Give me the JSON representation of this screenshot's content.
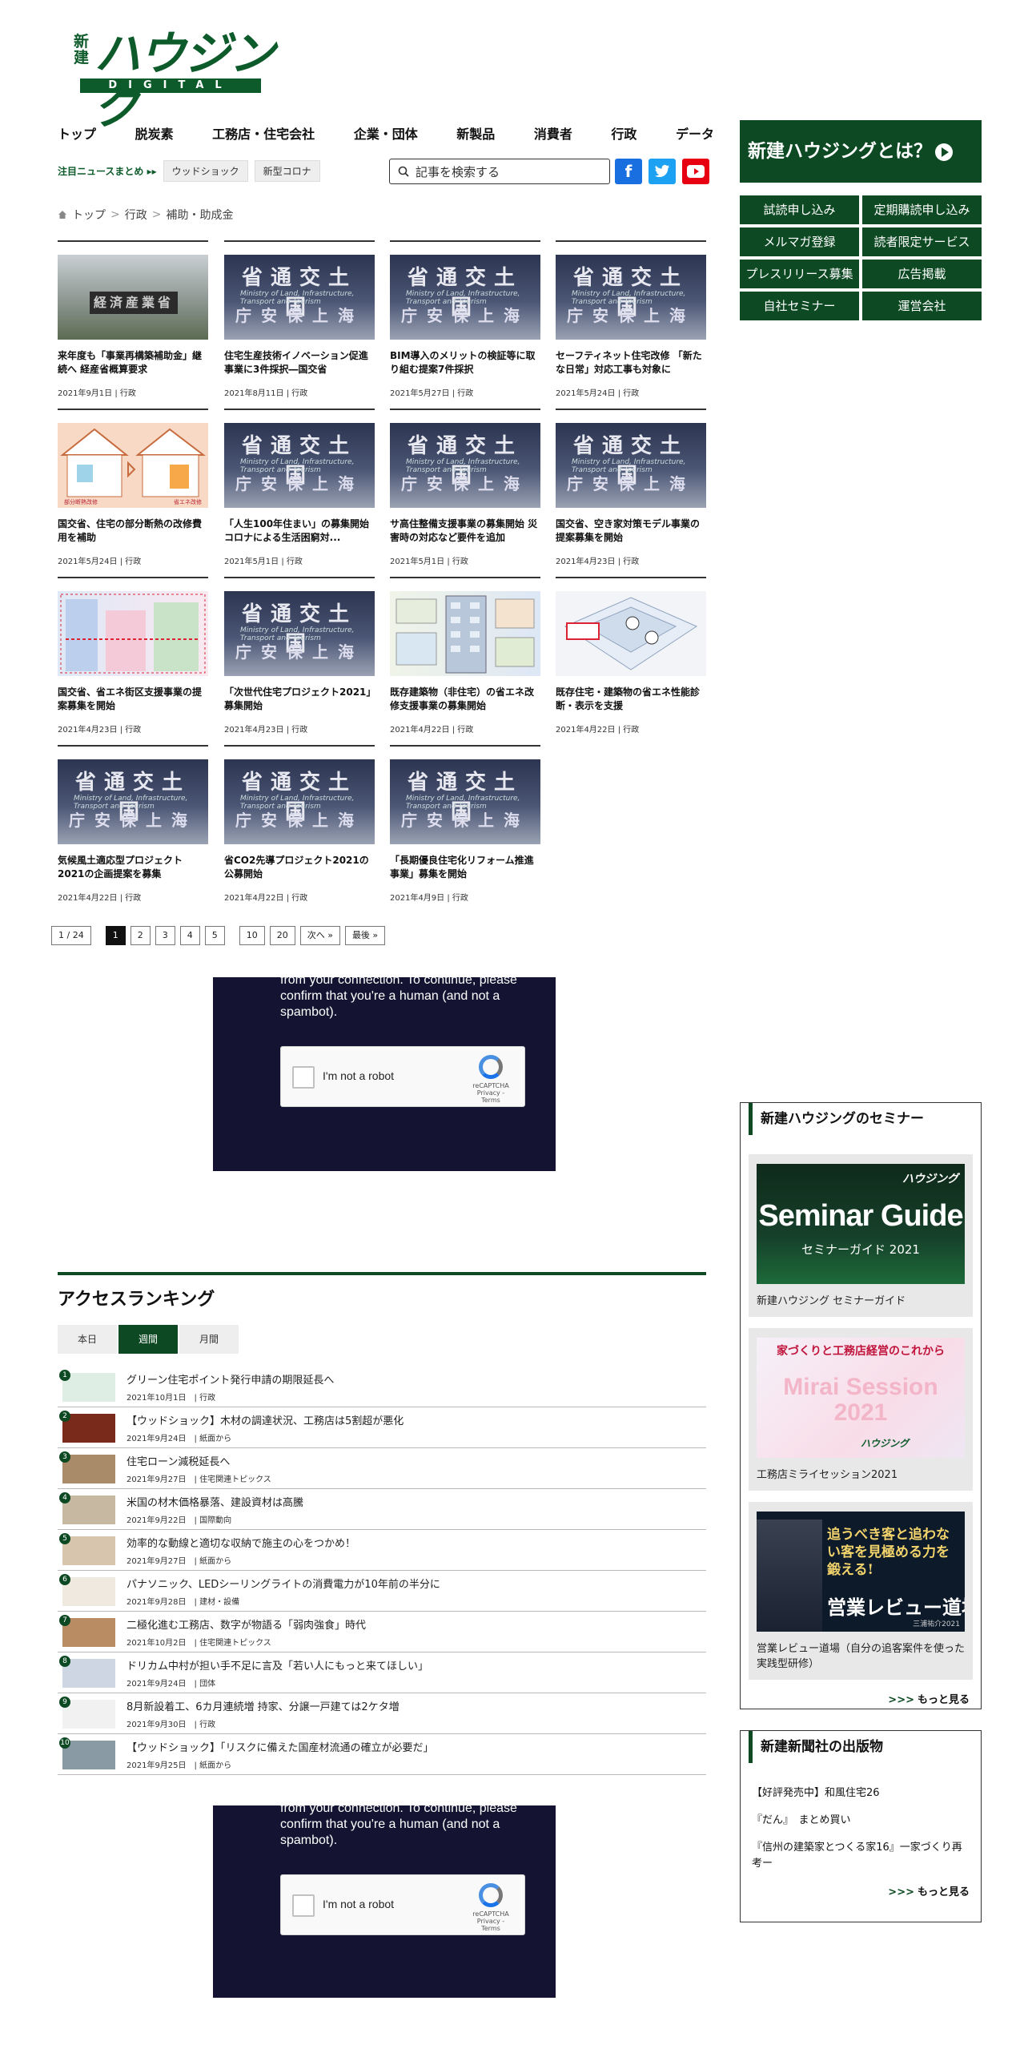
{
  "logo": {
    "prefix": "新建",
    "main": "ハウジング",
    "sub": "DIGITAL"
  },
  "nav": [
    "トップ",
    "脱炭素",
    "工務店・住宅会社",
    "企業・団体",
    "新製品",
    "消費者",
    "行政",
    "データ"
  ],
  "pickup": {
    "label": "注目ニュースまとめ ▸▸",
    "tags": [
      "ウッドショック",
      "新型コロナ"
    ]
  },
  "search": {
    "placeholder": "記事を検索する"
  },
  "sns": {
    "facebook": "f",
    "twitter": "t",
    "youtube": "▶"
  },
  "breadcrumb": [
    "トップ",
    "行政",
    "補助・助成金"
  ],
  "articles": [
    {
      "title": "来年度も「事業再構築補助金」継続へ 経産省概算要求",
      "date": "2021年9月1日",
      "cat": "行政",
      "image": "meti"
    },
    {
      "title": "住宅生産技術イノベーション促進事業に3件採択―国交省",
      "date": "2021年8月11日",
      "cat": "行政",
      "image": "mlit"
    },
    {
      "title": "BIM導入のメリットの検証等に取り組む提案7件採択",
      "date": "2021年5月27日",
      "cat": "行政",
      "image": "mlit"
    },
    {
      "title": "セーフティネット住宅改修 「新たな日常」対応工事も対象に",
      "date": "2021年5月24日",
      "cat": "行政",
      "image": "mlit"
    },
    {
      "title": "国交省、住宅の部分断熱の改修費用を補助",
      "date": "2021年5月24日",
      "cat": "行政",
      "image": "house"
    },
    {
      "title": "「人生100年住まい」の募集開始 コロナによる生活困窮対...",
      "date": "2021年5月1日",
      "cat": "行政",
      "image": "mlit"
    },
    {
      "title": "サ高住整備支援事業の募集開始 災害時の対応など要件を追加",
      "date": "2021年5月1日",
      "cat": "行政",
      "image": "mlit"
    },
    {
      "title": "国交省、空き家対策モデル事業の提案募集を開始",
      "date": "2021年4月23日",
      "cat": "行政",
      "image": "mlit"
    },
    {
      "title": "国交省、省エネ街区支援事業の提案募集を開始",
      "date": "2021年4月23日",
      "cat": "行政",
      "image": "diag"
    },
    {
      "title": "「次世代住宅プロジェクト2021」募集開始",
      "date": "2021年4月23日",
      "cat": "行政",
      "image": "mlit"
    },
    {
      "title": "既存建築物（非住宅）の省エネ改修支援事業の募集開始",
      "date": "2021年4月22日",
      "cat": "行政",
      "image": "bldg"
    },
    {
      "title": "既存住宅・建築物の省エネ性能診断・表示を支援",
      "date": "2021年4月22日",
      "cat": "行政",
      "image": "iso"
    },
    {
      "title": "気候風土適応型プロジェクト2021の企画提案を募集",
      "date": "2021年4月22日",
      "cat": "行政",
      "image": "mlit"
    },
    {
      "title": "省CO2先導プロジェクト2021の公募開始",
      "date": "2021年4月22日",
      "cat": "行政",
      "image": "mlit"
    },
    {
      "title": "「長期優良住宅化リフォーム推進事業」募集を開始",
      "date": "2021年4月9日",
      "cat": "行政",
      "image": "mlit"
    }
  ],
  "image_text": {
    "mlit_top": "省通交土国",
    "mlit_sub": "Ministry of Land, Infrastructure, Transport and Tourism",
    "mlit_bottom": "庁安保上海",
    "meti": "経済産業省",
    "house_left": "部分断熱改修",
    "house_right": "省エネ改修"
  },
  "pager": {
    "current_label": "1 / 24",
    "pages": [
      "1",
      "2",
      "3",
      "4",
      "5"
    ],
    "jumps": [
      "10",
      "20",
      "次へ »",
      "最後 »"
    ]
  },
  "recaptcha": {
    "message": "from your connection. To continue, please confirm that you're a human (and not a spambot).",
    "label": "I'm not a robot",
    "brand": "reCAPTCHA",
    "links": "Privacy - Terms"
  },
  "ranking": {
    "title": "アクセスランキング",
    "tabs": [
      "本日",
      "週間",
      "月間"
    ],
    "active_tab": "週間",
    "items": [
      {
        "n": "1",
        "title": "グリーン住宅ポイント発行申請の期限延長へ",
        "date": "2021年10月1日",
        "cat": "行政"
      },
      {
        "n": "2",
        "title": "【ウッドショック】木材の調達状況、工務店は5割超が悪化",
        "date": "2021年9月24日",
        "cat": "紙面から"
      },
      {
        "n": "3",
        "title": "住宅ローン減税延長へ",
        "date": "2021年9月27日",
        "cat": "住宅関連トピックス"
      },
      {
        "n": "4",
        "title": "米国の材木価格暴落、建設資材は高騰",
        "date": "2021年9月22日",
        "cat": "国際動向"
      },
      {
        "n": "5",
        "title": "効率的な動線と適切な収納で施主の心をつかめ！",
        "date": "2021年9月27日",
        "cat": "紙面から"
      },
      {
        "n": "6",
        "title": "パナソニック、LEDシーリングライトの消費電力が10年前の半分に",
        "date": "2021年9月28日",
        "cat": "建材・設備"
      },
      {
        "n": "7",
        "title": "二極化進む工務店、数字が物語る「弱肉強食」時代",
        "date": "2021年10月2日",
        "cat": "住宅関連トピックス"
      },
      {
        "n": "8",
        "title": "ドリカム中村が担い手不足に言及「若い人にもっと来てほしい」",
        "date": "2021年9月24日",
        "cat": "団体"
      },
      {
        "n": "9",
        "title": "8月新設着工、6カ月連続増 持家、分譲一戸建ては2ケタ増",
        "date": "2021年9月30日",
        "cat": "行政"
      },
      {
        "n": "10",
        "title": "【ウッドショック】「リスクに備えた国産材流通の確立が必要だ」",
        "date": "2021年9月25日",
        "cat": "紙面から"
      }
    ]
  },
  "sidebar": {
    "about": "新建ハウジングとは？",
    "buttons": [
      "試読申し込み",
      "定期購読申し込み",
      "メルマガ登録",
      "読者限定サービス",
      "プレスリリース募集",
      "広告掲載",
      "自社セミナー",
      "運営会社"
    ],
    "seminar_title": "新建ハウジングのセミナー",
    "seminars": [
      {
        "caption": "新建ハウジング セミナーガイド",
        "img_main": "Seminar Guide",
        "img_sub": "セミナーガイド 2021",
        "img_brand": "ハウジング"
      },
      {
        "caption": "工務店ミライセッション2021",
        "img_main": "Mirai Session 2021",
        "img_sub": "家づくりと工務店経営のこれから",
        "img_brand": "ハウジング"
      },
      {
        "caption": "営業レビュー道場（自分の追客案件を使った実践型研修）",
        "img_main": "営業レビュー道場",
        "img_sub": "追うべき客と追わない客を見極める力を鍛える!",
        "img_brand": "三浦祐介2021"
      }
    ],
    "more": "もっと見る",
    "more_prefix": ">>>",
    "pub_title": "新建新聞社の出版物",
    "pubs": [
      "【好評発売中】和風住宅26",
      "『だん』　まとめ買い",
      "『信州の建築家とつくる家16』一家づくり再考ー"
    ]
  },
  "colors": {
    "brand_green": "#0d4a23",
    "captcha_bg": "#141432"
  }
}
